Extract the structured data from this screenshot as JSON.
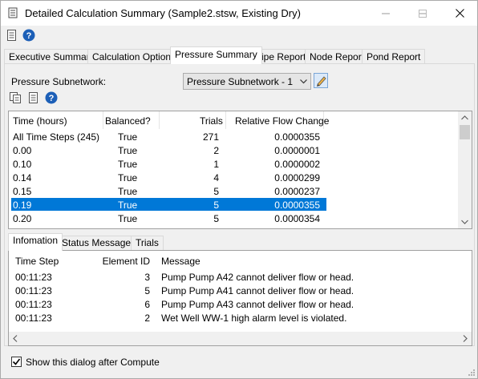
{
  "window": {
    "title": "Detailed Calculation Summary (Sample2.stsw, Existing Dry)"
  },
  "toolbar": {
    "report_icon": "report-icon",
    "help_icon": "help-icon"
  },
  "tabs": [
    {
      "label": "Executive Summary"
    },
    {
      "label": "Calculation Options"
    },
    {
      "label": "Pressure Summary",
      "active": true
    },
    {
      "label": "Pipe Report"
    },
    {
      "label": "Node Report"
    },
    {
      "label": "Pond Report"
    }
  ],
  "pressure": {
    "subnetwork_label": "Pressure Subnetwork:",
    "subnetwork_value": "Pressure Subnetwork - 1"
  },
  "grid": {
    "columns": [
      "Time (hours)",
      "Balanced?",
      "Trials",
      "Relative Flow Change"
    ],
    "rows": [
      [
        "All Time Steps (245)",
        "True",
        "271",
        "0.0000355"
      ],
      [
        "0.00",
        "True",
        "2",
        "0.0000001"
      ],
      [
        "0.10",
        "True",
        "1",
        "0.0000002"
      ],
      [
        "0.14",
        "True",
        "4",
        "0.0000299"
      ],
      [
        "0.15",
        "True",
        "5",
        "0.0000237"
      ],
      [
        "0.19",
        "True",
        "5",
        "0.0000355"
      ],
      [
        "0.20",
        "True",
        "5",
        "0.0000354"
      ]
    ],
    "selected_row": 5
  },
  "lower_tabs": [
    {
      "label": "Infomation",
      "active": true
    },
    {
      "label": "Status Messages"
    },
    {
      "label": "Trials"
    }
  ],
  "messages": {
    "columns": [
      "Time Step",
      "Element ID",
      "Message"
    ],
    "rows": [
      [
        "00:11:23",
        "3",
        "Pump Pump A42 cannot deliver flow or head."
      ],
      [
        "00:11:23",
        "5",
        "Pump Pump A41 cannot deliver flow or head."
      ],
      [
        "00:11:23",
        "6",
        "Pump Pump A43 cannot deliver flow or head."
      ],
      [
        "00:11:23",
        "2",
        "Wet Well WW-1 high alarm level is violated."
      ]
    ]
  },
  "footer": {
    "show_dialog_label": "Show this dialog after Compute",
    "show_dialog_checked": true
  },
  "colors": {
    "selection": "#0078d7",
    "help_blue": "#1c5fb7"
  }
}
